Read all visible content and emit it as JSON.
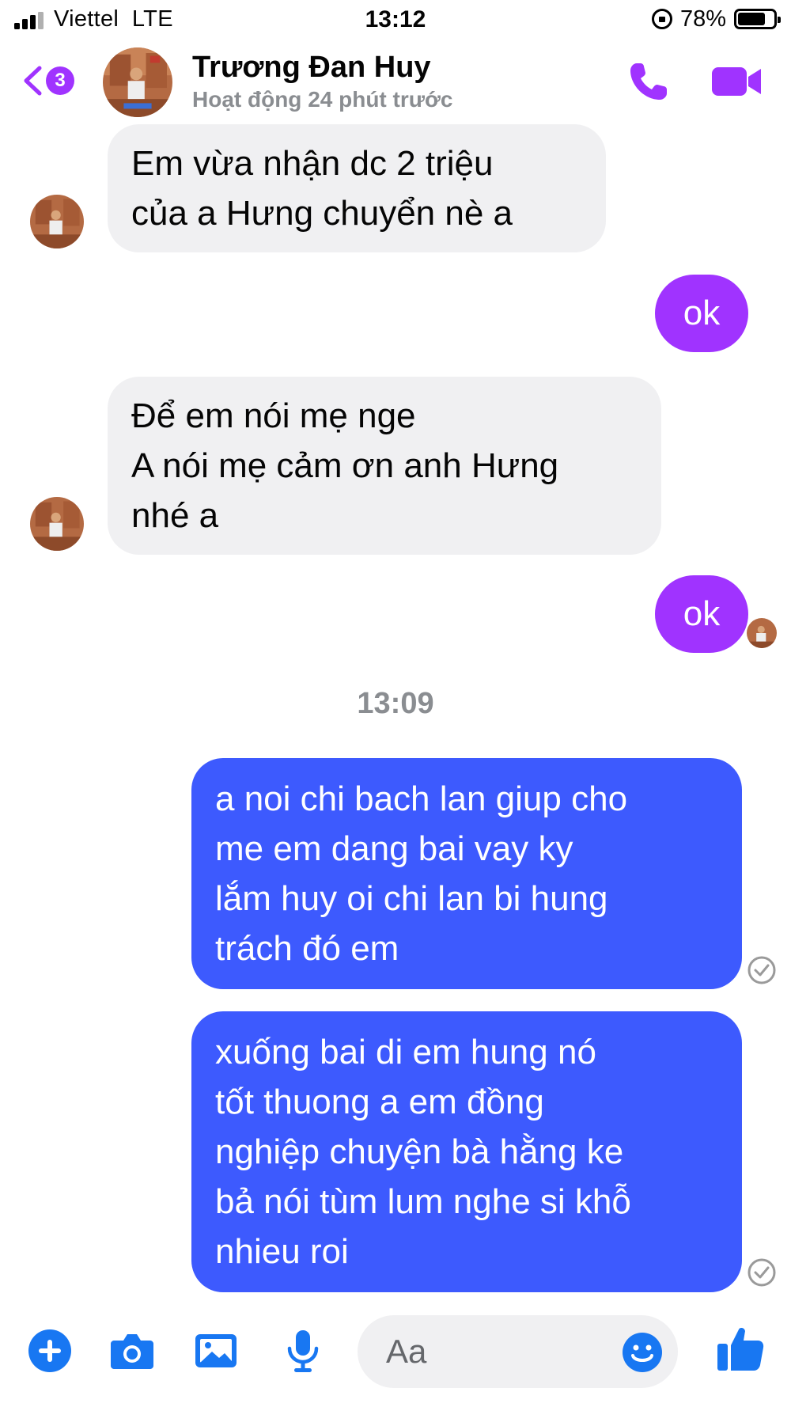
{
  "status_bar": {
    "carrier": "Viettel",
    "network": "LTE",
    "time": "13:12",
    "battery_percent": "78%",
    "battery_level": 0.78
  },
  "header": {
    "back_badge": "3",
    "contact_name": "Trương Đan Huy",
    "contact_status": "Hoạt động 24 phút trước",
    "accent_color": "#a033ff"
  },
  "messages": [
    {
      "direction": "incoming",
      "text": "Em vừa nhận dc 2 triệu\ncủa a Hưng chuyển nè a"
    },
    {
      "direction": "outgoing",
      "text": "ok"
    },
    {
      "direction": "incoming",
      "text": "Để em nói mẹ nge\nA nói mẹ cảm ơn anh Hưng\nnhé a"
    },
    {
      "direction": "outgoing",
      "text": "ok"
    },
    {
      "direction": "timestamp",
      "text": "13:09"
    },
    {
      "direction": "outgoing",
      "text": "a noi chi bach lan giup cho\nme em dang bai vay ky\nlắm huy oi chi lan bi hung\ntrách đó em"
    },
    {
      "direction": "outgoing",
      "text": "xuống bai di em hung nó\ntốt thuong a em đồng\nnghiệp chuyện bà hằng ke\nbả nói tùm lum nghe si khỗ\nnhieu roi"
    }
  ],
  "composer": {
    "placeholder": "Aa"
  },
  "icons": {
    "toolbar": [
      "plus-icon",
      "camera-icon",
      "gallery-icon",
      "microphone-icon"
    ],
    "emoji": "emoji-icon",
    "like": "thumbs-up-icon",
    "call": "phone-icon",
    "video": "video-camera-icon"
  },
  "colors": {
    "outgoing_bubble": "#3d5afe",
    "accent_bubble": "#a033ff",
    "incoming_bubble": "#f0f0f2",
    "toolbar_blue": "#1877f2"
  }
}
